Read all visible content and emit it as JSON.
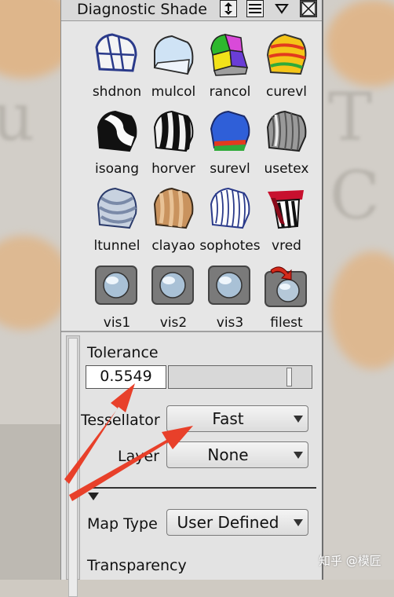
{
  "window": {
    "title": "Diagnostic Shade"
  },
  "titlebar_icons": [
    "resize-vertical-icon",
    "list-icon",
    "dropdown-triangle-icon",
    "close-icon"
  ],
  "shelf": {
    "rows": [
      [
        "shdnon",
        "mulcol",
        "rancol",
        "curevl"
      ],
      [
        "isoang",
        "horver",
        "surevl",
        "usetex"
      ],
      [
        "ltunnel",
        "clayao",
        "sophotes",
        "vred"
      ],
      [
        "vis1",
        "vis2",
        "vis3",
        "filest"
      ]
    ]
  },
  "tolerance": {
    "label": "Tolerance",
    "value": "0.5549"
  },
  "tessellator": {
    "label": "Tessellator",
    "value": "Fast"
  },
  "layer": {
    "label": "Layer",
    "value": "None"
  },
  "map_type": {
    "label": "Map Type",
    "value": "User Defined"
  },
  "transparency": {
    "label": "Transparency"
  },
  "watermark": "知乎 @模匠",
  "colors": {
    "annotation_arrow": "#e8402a",
    "panel_bg": "#e3e3e3"
  }
}
